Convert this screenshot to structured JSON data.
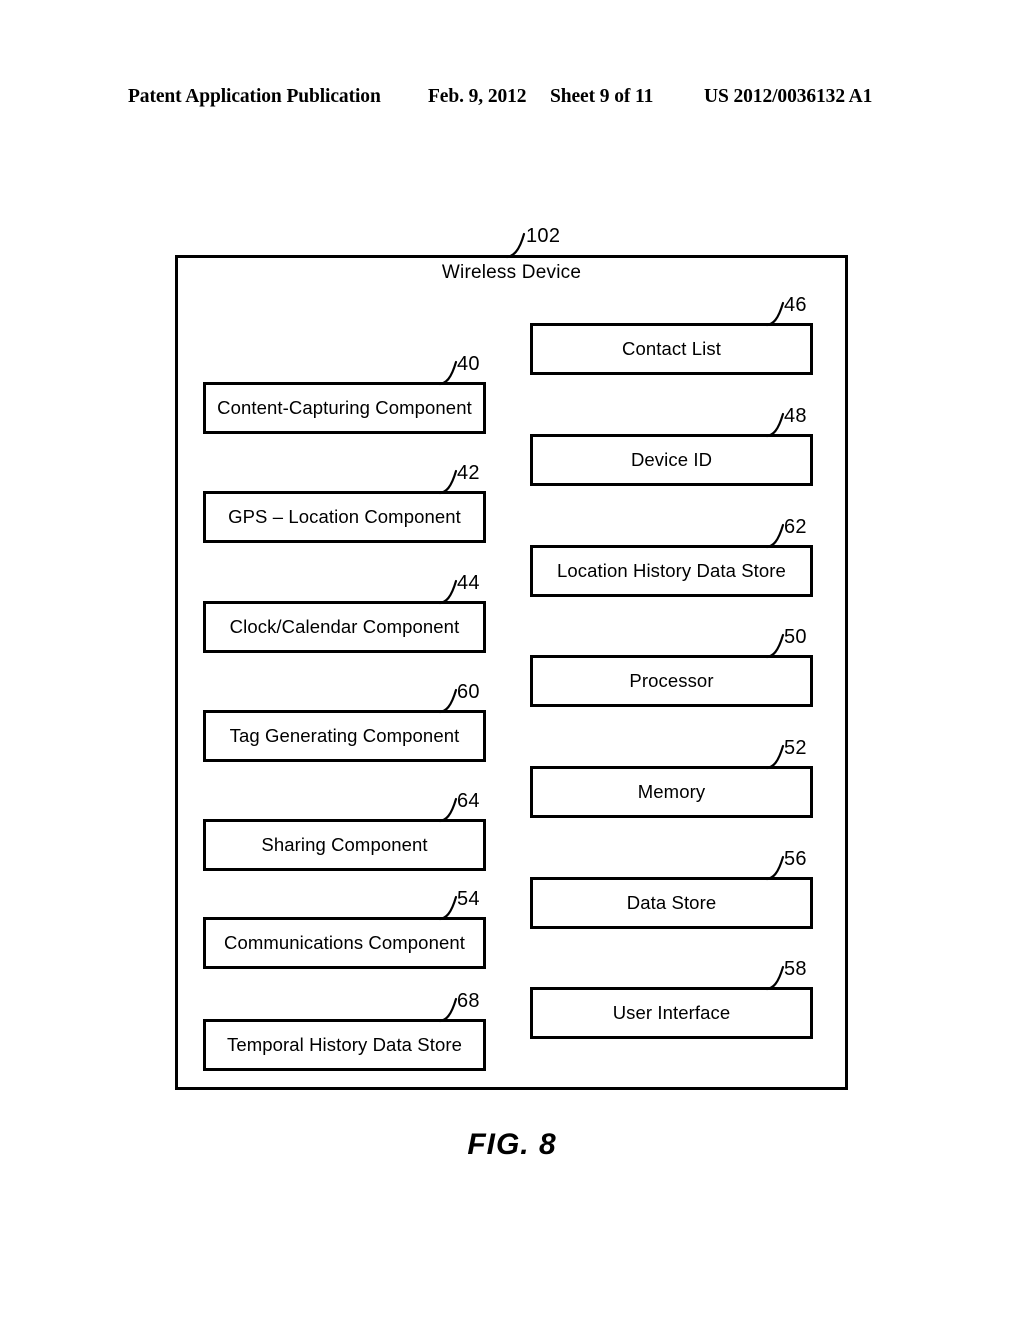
{
  "header": {
    "publication": "Patent Application Publication",
    "date": "Feb. 9, 2012",
    "sheet": "Sheet 9 of 11",
    "patent_number": "US 2012/0036132 A1"
  },
  "figure": {
    "caption": "FIG. 8",
    "container": {
      "title": "Wireless Device",
      "ref": "102"
    },
    "left_column": [
      {
        "label": "Content-Capturing Component",
        "ref": "40"
      },
      {
        "label": "GPS – Location Component",
        "ref": "42"
      },
      {
        "label": "Clock/Calendar Component",
        "ref": "44"
      },
      {
        "label": "Tag Generating Component",
        "ref": "60"
      },
      {
        "label": "Sharing Component",
        "ref": "64"
      },
      {
        "label": "Communications Component",
        "ref": "54"
      },
      {
        "label": "Temporal History Data Store",
        "ref": "68"
      }
    ],
    "right_column": [
      {
        "label": "Contact List",
        "ref": "46"
      },
      {
        "label": "Device ID",
        "ref": "48"
      },
      {
        "label": "Location History Data Store",
        "ref": "62"
      },
      {
        "label": "Processor",
        "ref": "50"
      },
      {
        "label": "Memory",
        "ref": "52"
      },
      {
        "label": "Data Store",
        "ref": "56"
      },
      {
        "label": "User Interface",
        "ref": "58"
      }
    ]
  }
}
